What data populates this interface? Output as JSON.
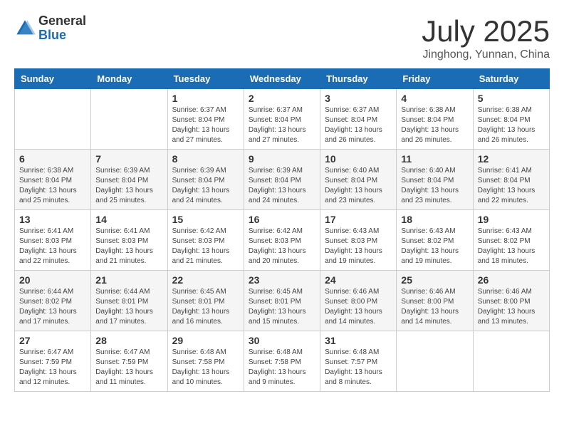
{
  "logo": {
    "general": "General",
    "blue": "Blue"
  },
  "title": "July 2025",
  "subtitle": "Jinghong, Yunnan, China",
  "days_of_week": [
    "Sunday",
    "Monday",
    "Tuesday",
    "Wednesday",
    "Thursday",
    "Friday",
    "Saturday"
  ],
  "weeks": [
    [
      {
        "day": "",
        "sunrise": "",
        "sunset": "",
        "daylight": ""
      },
      {
        "day": "",
        "sunrise": "",
        "sunset": "",
        "daylight": ""
      },
      {
        "day": "1",
        "sunrise": "Sunrise: 6:37 AM",
        "sunset": "Sunset: 8:04 PM",
        "daylight": "Daylight: 13 hours and 27 minutes."
      },
      {
        "day": "2",
        "sunrise": "Sunrise: 6:37 AM",
        "sunset": "Sunset: 8:04 PM",
        "daylight": "Daylight: 13 hours and 27 minutes."
      },
      {
        "day": "3",
        "sunrise": "Sunrise: 6:37 AM",
        "sunset": "Sunset: 8:04 PM",
        "daylight": "Daylight: 13 hours and 26 minutes."
      },
      {
        "day": "4",
        "sunrise": "Sunrise: 6:38 AM",
        "sunset": "Sunset: 8:04 PM",
        "daylight": "Daylight: 13 hours and 26 minutes."
      },
      {
        "day": "5",
        "sunrise": "Sunrise: 6:38 AM",
        "sunset": "Sunset: 8:04 PM",
        "daylight": "Daylight: 13 hours and 26 minutes."
      }
    ],
    [
      {
        "day": "6",
        "sunrise": "Sunrise: 6:38 AM",
        "sunset": "Sunset: 8:04 PM",
        "daylight": "Daylight: 13 hours and 25 minutes."
      },
      {
        "day": "7",
        "sunrise": "Sunrise: 6:39 AM",
        "sunset": "Sunset: 8:04 PM",
        "daylight": "Daylight: 13 hours and 25 minutes."
      },
      {
        "day": "8",
        "sunrise": "Sunrise: 6:39 AM",
        "sunset": "Sunset: 8:04 PM",
        "daylight": "Daylight: 13 hours and 24 minutes."
      },
      {
        "day": "9",
        "sunrise": "Sunrise: 6:39 AM",
        "sunset": "Sunset: 8:04 PM",
        "daylight": "Daylight: 13 hours and 24 minutes."
      },
      {
        "day": "10",
        "sunrise": "Sunrise: 6:40 AM",
        "sunset": "Sunset: 8:04 PM",
        "daylight": "Daylight: 13 hours and 23 minutes."
      },
      {
        "day": "11",
        "sunrise": "Sunrise: 6:40 AM",
        "sunset": "Sunset: 8:04 PM",
        "daylight": "Daylight: 13 hours and 23 minutes."
      },
      {
        "day": "12",
        "sunrise": "Sunrise: 6:41 AM",
        "sunset": "Sunset: 8:04 PM",
        "daylight": "Daylight: 13 hours and 22 minutes."
      }
    ],
    [
      {
        "day": "13",
        "sunrise": "Sunrise: 6:41 AM",
        "sunset": "Sunset: 8:03 PM",
        "daylight": "Daylight: 13 hours and 22 minutes."
      },
      {
        "day": "14",
        "sunrise": "Sunrise: 6:41 AM",
        "sunset": "Sunset: 8:03 PM",
        "daylight": "Daylight: 13 hours and 21 minutes."
      },
      {
        "day": "15",
        "sunrise": "Sunrise: 6:42 AM",
        "sunset": "Sunset: 8:03 PM",
        "daylight": "Daylight: 13 hours and 21 minutes."
      },
      {
        "day": "16",
        "sunrise": "Sunrise: 6:42 AM",
        "sunset": "Sunset: 8:03 PM",
        "daylight": "Daylight: 13 hours and 20 minutes."
      },
      {
        "day": "17",
        "sunrise": "Sunrise: 6:43 AM",
        "sunset": "Sunset: 8:03 PM",
        "daylight": "Daylight: 13 hours and 19 minutes."
      },
      {
        "day": "18",
        "sunrise": "Sunrise: 6:43 AM",
        "sunset": "Sunset: 8:02 PM",
        "daylight": "Daylight: 13 hours and 19 minutes."
      },
      {
        "day": "19",
        "sunrise": "Sunrise: 6:43 AM",
        "sunset": "Sunset: 8:02 PM",
        "daylight": "Daylight: 13 hours and 18 minutes."
      }
    ],
    [
      {
        "day": "20",
        "sunrise": "Sunrise: 6:44 AM",
        "sunset": "Sunset: 8:02 PM",
        "daylight": "Daylight: 13 hours and 17 minutes."
      },
      {
        "day": "21",
        "sunrise": "Sunrise: 6:44 AM",
        "sunset": "Sunset: 8:01 PM",
        "daylight": "Daylight: 13 hours and 17 minutes."
      },
      {
        "day": "22",
        "sunrise": "Sunrise: 6:45 AM",
        "sunset": "Sunset: 8:01 PM",
        "daylight": "Daylight: 13 hours and 16 minutes."
      },
      {
        "day": "23",
        "sunrise": "Sunrise: 6:45 AM",
        "sunset": "Sunset: 8:01 PM",
        "daylight": "Daylight: 13 hours and 15 minutes."
      },
      {
        "day": "24",
        "sunrise": "Sunrise: 6:46 AM",
        "sunset": "Sunset: 8:00 PM",
        "daylight": "Daylight: 13 hours and 14 minutes."
      },
      {
        "day": "25",
        "sunrise": "Sunrise: 6:46 AM",
        "sunset": "Sunset: 8:00 PM",
        "daylight": "Daylight: 13 hours and 14 minutes."
      },
      {
        "day": "26",
        "sunrise": "Sunrise: 6:46 AM",
        "sunset": "Sunset: 8:00 PM",
        "daylight": "Daylight: 13 hours and 13 minutes."
      }
    ],
    [
      {
        "day": "27",
        "sunrise": "Sunrise: 6:47 AM",
        "sunset": "Sunset: 7:59 PM",
        "daylight": "Daylight: 13 hours and 12 minutes."
      },
      {
        "day": "28",
        "sunrise": "Sunrise: 6:47 AM",
        "sunset": "Sunset: 7:59 PM",
        "daylight": "Daylight: 13 hours and 11 minutes."
      },
      {
        "day": "29",
        "sunrise": "Sunrise: 6:48 AM",
        "sunset": "Sunset: 7:58 PM",
        "daylight": "Daylight: 13 hours and 10 minutes."
      },
      {
        "day": "30",
        "sunrise": "Sunrise: 6:48 AM",
        "sunset": "Sunset: 7:58 PM",
        "daylight": "Daylight: 13 hours and 9 minutes."
      },
      {
        "day": "31",
        "sunrise": "Sunrise: 6:48 AM",
        "sunset": "Sunset: 7:57 PM",
        "daylight": "Daylight: 13 hours and 8 minutes."
      },
      {
        "day": "",
        "sunrise": "",
        "sunset": "",
        "daylight": ""
      },
      {
        "day": "",
        "sunrise": "",
        "sunset": "",
        "daylight": ""
      }
    ]
  ]
}
